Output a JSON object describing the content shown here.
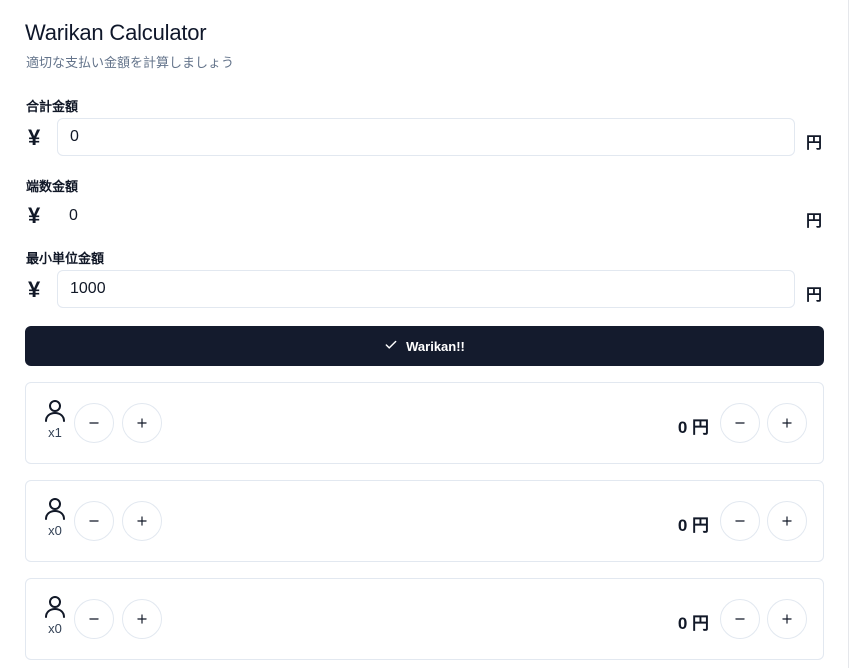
{
  "header": {
    "title": "Warikan Calculator",
    "subtitle": "適切な支払い金額を計算しましょう"
  },
  "fields": {
    "total": {
      "label": "合計金額",
      "currency": "¥",
      "value": "0",
      "unit": "円"
    },
    "remainder": {
      "label": "端数金額",
      "currency": "¥",
      "value": "0",
      "unit": "円"
    },
    "min_unit": {
      "label": "最小単位金額",
      "currency": "¥",
      "value": "1000",
      "unit": "円"
    }
  },
  "action": {
    "label": "Warikan!!"
  },
  "groups": [
    {
      "multiplier": "x1",
      "amount": "0 円"
    },
    {
      "multiplier": "x0",
      "amount": "0 円"
    },
    {
      "multiplier": "x0",
      "amount": "0 円"
    }
  ],
  "icons": {
    "check": "check-icon",
    "user": "user-icon",
    "minus": "minus-icon",
    "plus": "plus-icon"
  },
  "colors": {
    "primary_button": "#141b2d",
    "border": "#e2e8f0",
    "muted_text": "#64748b"
  }
}
